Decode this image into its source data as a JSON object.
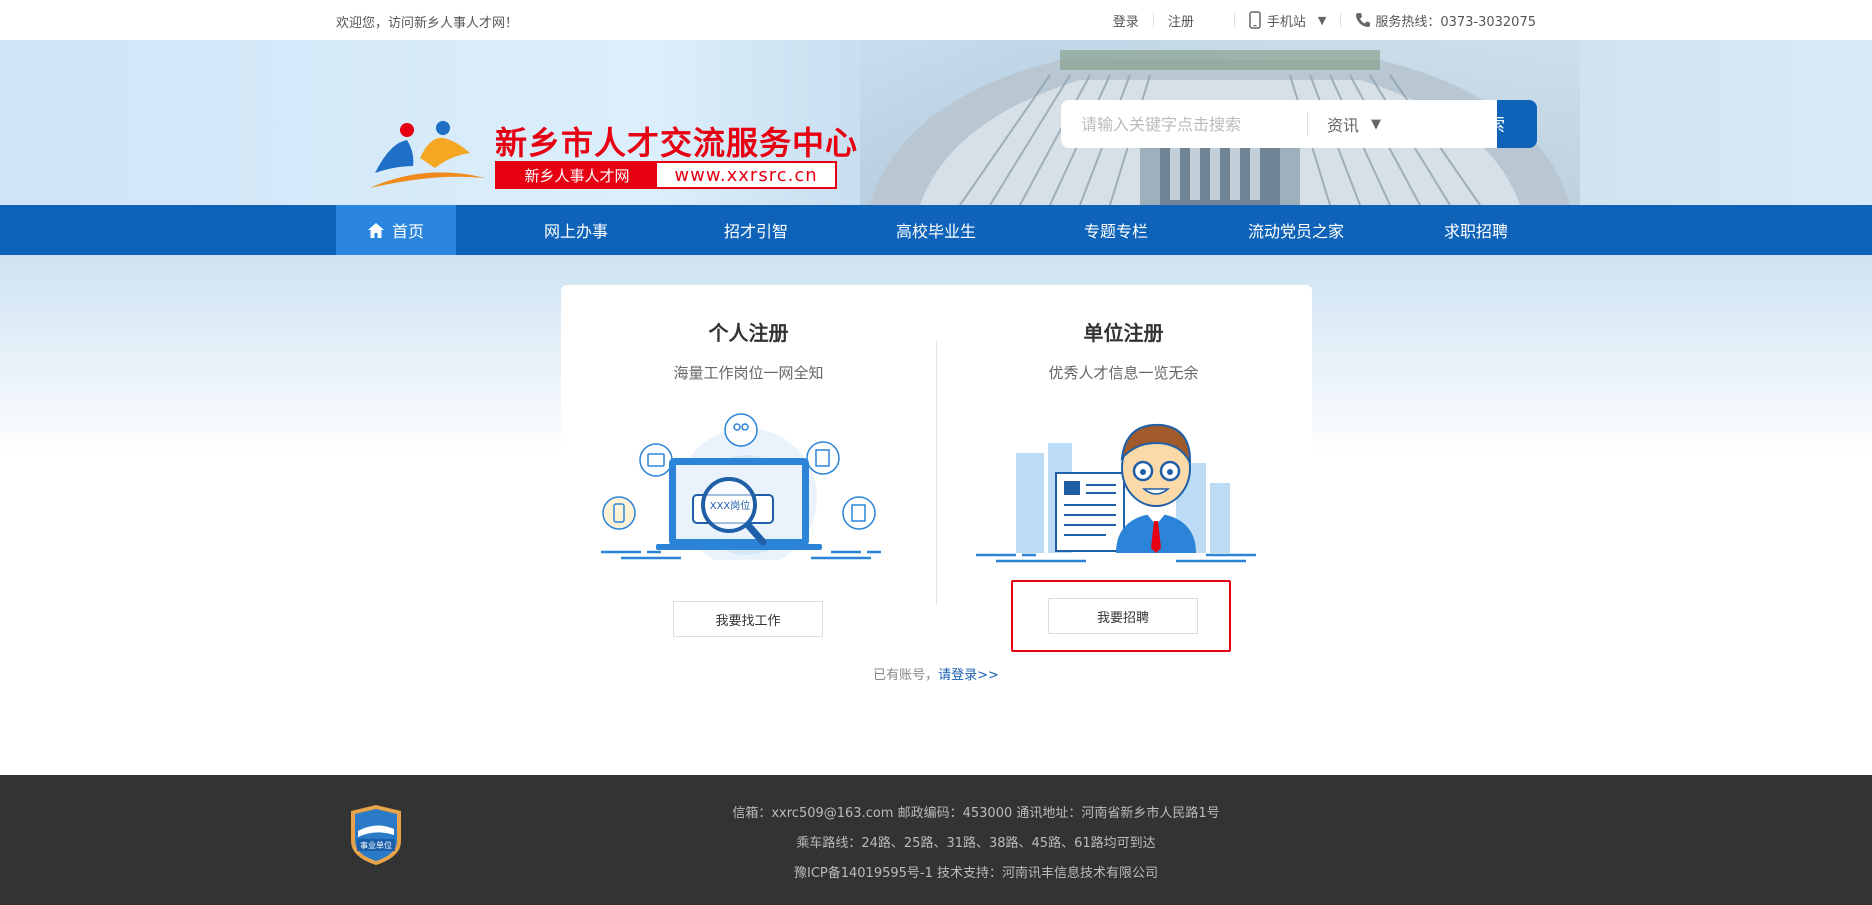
{
  "topbar": {
    "welcome": "欢迎您，访问新乡人事人才网！",
    "login": "登录",
    "register": "注册",
    "mobile": "手机站",
    "hotline": "服务热线：0373-3032075"
  },
  "header": {
    "site_title": "新乡市人才交流服务中心",
    "site_name": "新乡人事人才网",
    "site_url": "www.xxrsrc.cn"
  },
  "search": {
    "placeholder": "请输入关键字点击搜索",
    "category": "资讯",
    "button": "搜索"
  },
  "nav": {
    "items": [
      {
        "label": "首页"
      },
      {
        "label": "网上办事"
      },
      {
        "label": "招才引智"
      },
      {
        "label": "高校毕业生"
      },
      {
        "label": "专题专栏"
      },
      {
        "label": "流动党员之家"
      },
      {
        "label": "求职招聘"
      }
    ]
  },
  "register": {
    "personal": {
      "title": "个人注册",
      "subtitle": "海量工作岗位一网全知",
      "screen_text": "XXX岗位",
      "button": "我要找工作"
    },
    "company": {
      "title": "单位注册",
      "subtitle": "优秀人才信息一览无余",
      "button": "我要招聘"
    },
    "has_account": "已有账号，",
    "login_link": "请登录>>"
  },
  "footer": {
    "line1": "信箱：xxrc509@163.com 邮政编码：453000 通讯地址：河南省新乡市人民路1号",
    "line2": "乘车路线：24路、25路、31路、38路、45路、61路均可到达",
    "line3": "豫ICP备14019595号-1 技术支持：河南讯丰信息技术有限公司",
    "badge_text": "事业单位"
  },
  "colors": {
    "nav_blue": "#0e63b8",
    "nav_active": "#2a86de",
    "brand_red": "#e60012",
    "footer_bg": "#333333"
  }
}
